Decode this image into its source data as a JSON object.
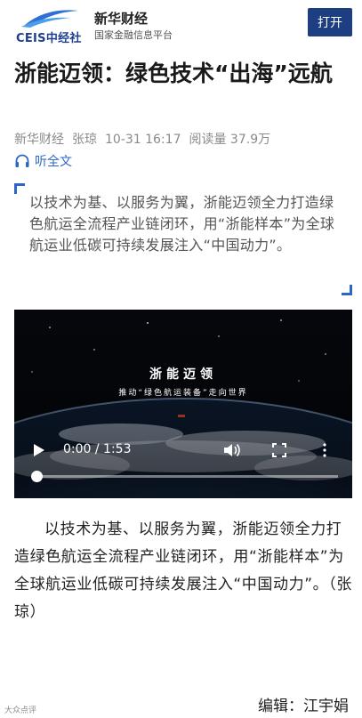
{
  "header": {
    "logo_text": "CEIS中经社",
    "app_name": "新华财经",
    "app_subtitle": "国家金融信息平台",
    "open_button": "打开"
  },
  "article": {
    "title": "浙能迈领：绿色技术“出海”远航",
    "source": "新华财经",
    "author": "张琼",
    "datetime": "10-31 16:17",
    "read_count": "阅读量 37.9万",
    "listen_label": "听全文",
    "summary": "以技术为基、以服务为翼，浙能迈领全力打造绿色航运全流程产业链闭环，用“浙能样本”为全球航运业低碳可持续发展注入“中国动力”。",
    "body": "以技术为基、以服务为翼，浙能迈领全力打造绿色航运全流程产业链闭环，用“浙能样本”为全球航运业低碳可持续发展注入“中国动力”。（张琼）",
    "editor": "编辑：江宇娟"
  },
  "video": {
    "overlay_title": "浙能迈领",
    "overlay_subtitle": "推动“绿色航运装备”走向世界",
    "time": "0:00 / 1:53",
    "progress": 0,
    "icons": [
      "play-icon",
      "volume-icon",
      "fullscreen-icon",
      "more-vertical-icon"
    ]
  },
  "footer": {
    "watermark": "大众点评"
  },
  "colors": {
    "accent": "#2a67c8",
    "button": "#1d3f82",
    "meta": "#8a8a8a"
  }
}
